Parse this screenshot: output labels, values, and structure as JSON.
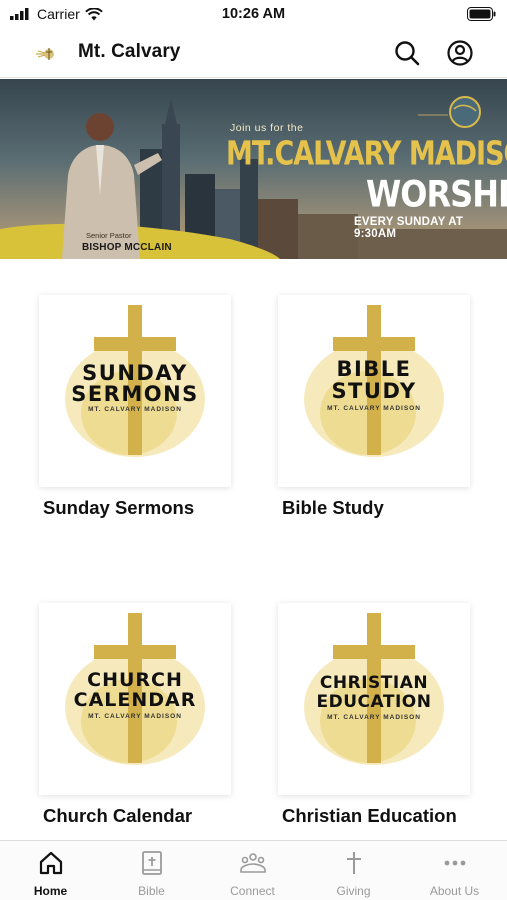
{
  "status_bar": {
    "carrier": "Carrier",
    "time": "10:26 AM"
  },
  "header": {
    "title": "Mt. Calvary",
    "logo_icon": "church-logo-icon",
    "search_icon": "search-icon",
    "account_icon": "account-icon"
  },
  "banner": {
    "invite": "Join us for the",
    "church": "MT.CALVARY MADISON",
    "event": "WORSHIP",
    "time": "EVERY SUNDAY AT 9:30AM",
    "pastor_role": "Senior Pastor",
    "pastor_name": "BISHOP MCCLAIN",
    "accent_color": "#e4c24b"
  },
  "tiles": [
    {
      "art_line1": "SUNDAY",
      "art_line2": "SERMONS",
      "art_sub": "MT. CALVARY MADISON",
      "caption": "Sunday Sermons"
    },
    {
      "art_line1": "BIBLE",
      "art_line2": "STUDY",
      "art_sub": "MT. CALVARY MADISON",
      "caption": "Bible Study"
    },
    {
      "art_line1": "CHURCH",
      "art_line2": "CALENDAR",
      "art_sub": "MT. CALVARY MADISON",
      "caption": "Church Calendar"
    },
    {
      "art_line1": "CHRISTIAN",
      "art_line2": "EDUCATION",
      "art_sub": "MT. CALVARY MADISON",
      "caption": "Christian Education"
    }
  ],
  "tabs": [
    {
      "label": "Home",
      "icon": "home-icon",
      "active": true
    },
    {
      "label": "Bible",
      "icon": "bible-icon",
      "active": false
    },
    {
      "label": "Connect",
      "icon": "people-icon",
      "active": false
    },
    {
      "label": "Giving",
      "icon": "cross-icon",
      "active": false
    },
    {
      "label": "About Us",
      "icon": "more-icon",
      "active": false
    }
  ]
}
